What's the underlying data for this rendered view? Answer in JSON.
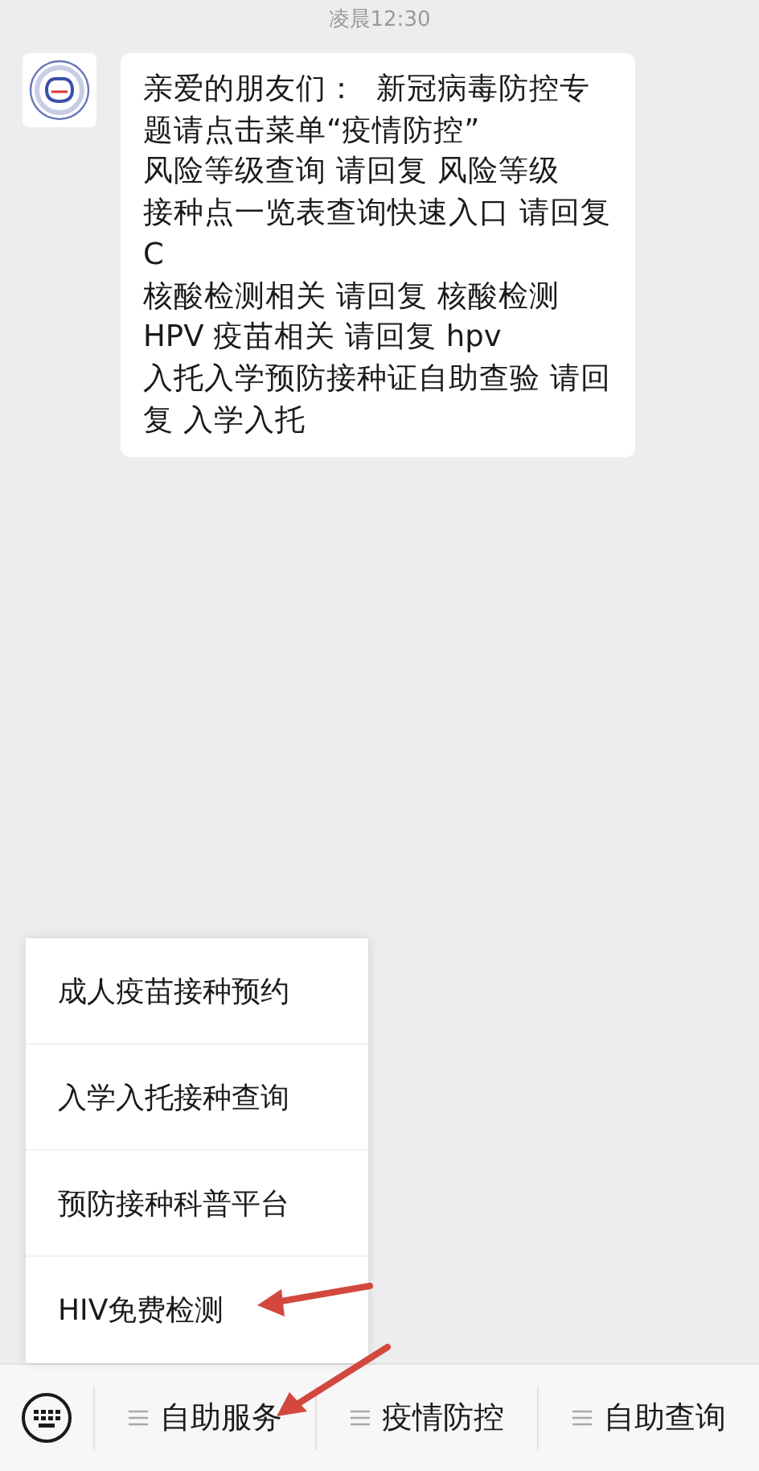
{
  "timestamp": "凌晨12:30",
  "messages": [
    {
      "kind": "incoming",
      "lines": [
        "亲爱的朋友们：  新冠病毒防控专题请点击菜单“疫情防控”",
        "风险等级查询 请回复 风险等级",
        "接种点一览表查询快速入口 请回复 C",
        "核酸检测相关 请回复 核酸检测",
        "HPV 疫苗相关 请回复 hpv",
        "入托入学预防接种证自助查验 请回复 入学入托"
      ]
    }
  ],
  "popup_menu": {
    "items": [
      {
        "label": "成人疫苗接种预约"
      },
      {
        "label": "入学入托接种查询"
      },
      {
        "label": "预防接种科普平台"
      },
      {
        "label": "HIV免费检测"
      }
    ]
  },
  "bottom_menu": {
    "items": [
      {
        "label": "自助服务"
      },
      {
        "label": "疫情防控"
      },
      {
        "label": "自助查询"
      }
    ]
  }
}
